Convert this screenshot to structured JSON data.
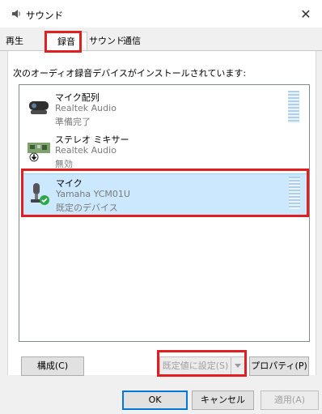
{
  "window": {
    "title": "サウンド",
    "close_glyph": "✕"
  },
  "tabs": [
    {
      "label": "再生"
    },
    {
      "label": "録音",
      "active": true
    },
    {
      "label": "サウンド"
    },
    {
      "label": "通信"
    }
  ],
  "instruction": "次のオーディオ録音デバイスがインストールされています:",
  "devices": [
    {
      "name": "マイク配列",
      "driver": "Realtek Audio",
      "status": "準備完了",
      "icon": "webcam-microphone-icon",
      "selected": false
    },
    {
      "name": "ステレオ ミキサー",
      "driver": "Realtek Audio",
      "status": "無効",
      "icon": "sound-card-icon",
      "selected": false
    },
    {
      "name": "マイク",
      "driver": "Yamaha YCM01U",
      "status": "既定のデバイス",
      "icon": "desk-microphone-icon",
      "selected": true
    }
  ],
  "buttons": {
    "configure": "構成(C)",
    "set_default": "既定値に設定(S)",
    "properties": "プロパティ(P)",
    "ok": "OK",
    "cancel": "キャンセル",
    "apply": "適用(A)"
  },
  "colors": {
    "highlight": "#e02020",
    "selection_bg": "#cce8ff",
    "default_badge": "#2aa84a"
  }
}
